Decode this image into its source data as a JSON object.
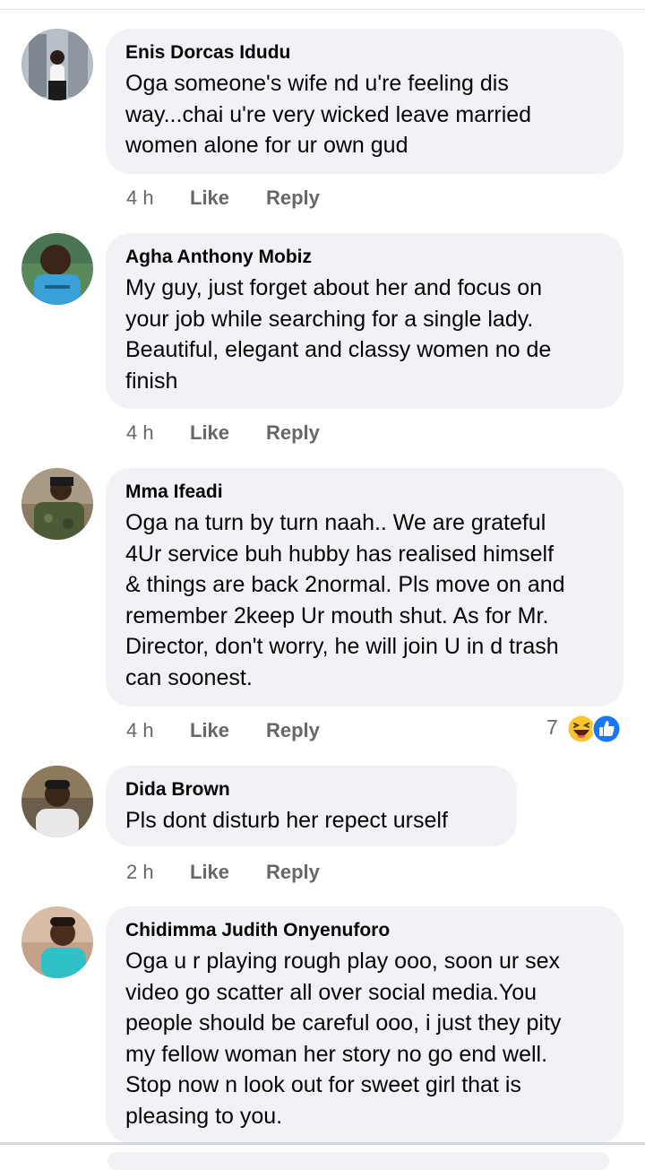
{
  "comments": [
    {
      "author": "Enis Dorcas Idudu",
      "text": "Oga someone's wife nd u're feeling dis\nway...chai u're very wicked leave married\nwomen alone for ur own gud",
      "time": "4 h",
      "like_label": "Like",
      "reply_label": "Reply"
    },
    {
      "author": "Agha Anthony Mobiz",
      "text": "My guy, just forget about her and focus on\nyour job while searching for a single lady.\nBeautiful, elegant and classy women no de\nfinish",
      "time": "4 h",
      "like_label": "Like",
      "reply_label": "Reply"
    },
    {
      "author": "Mma Ifeadi",
      "text": "Oga na turn by turn naah.. We are grateful\n4Ur service buh hubby has realised himself\n& things are back 2normal. Pls move on and\nremember 2keep Ur mouth shut. As for Mr.\nDirector, don't worry, he will join U in d trash\ncan soonest.",
      "time": "4 h",
      "like_label": "Like",
      "reply_label": "Reply",
      "reaction_count": "7",
      "reactions": [
        "haha-emoji-icon",
        "like-thumb-icon"
      ]
    },
    {
      "author": "Dida Brown",
      "text": "Pls  dont disturb  her repect urself",
      "time": "2 h",
      "like_label": "Like",
      "reply_label": "Reply"
    },
    {
      "author": "Chidimma Judith Onyenuforo",
      "text": "Oga u r playing rough play ooo, soon ur sex\nvideo go scatter all over social media.You\npeople should be careful ooo, i just they pity\nmy fellow woman her story no go end well.\nStop now n look out for sweet girl that is\npleasing to you."
    }
  ],
  "colors": {
    "bubble_bg": "#f0f2f5",
    "text": "#050505",
    "secondary_text": "#65676b",
    "like_blue": "#1877f2",
    "haha_yellow": "#f7c52e"
  }
}
